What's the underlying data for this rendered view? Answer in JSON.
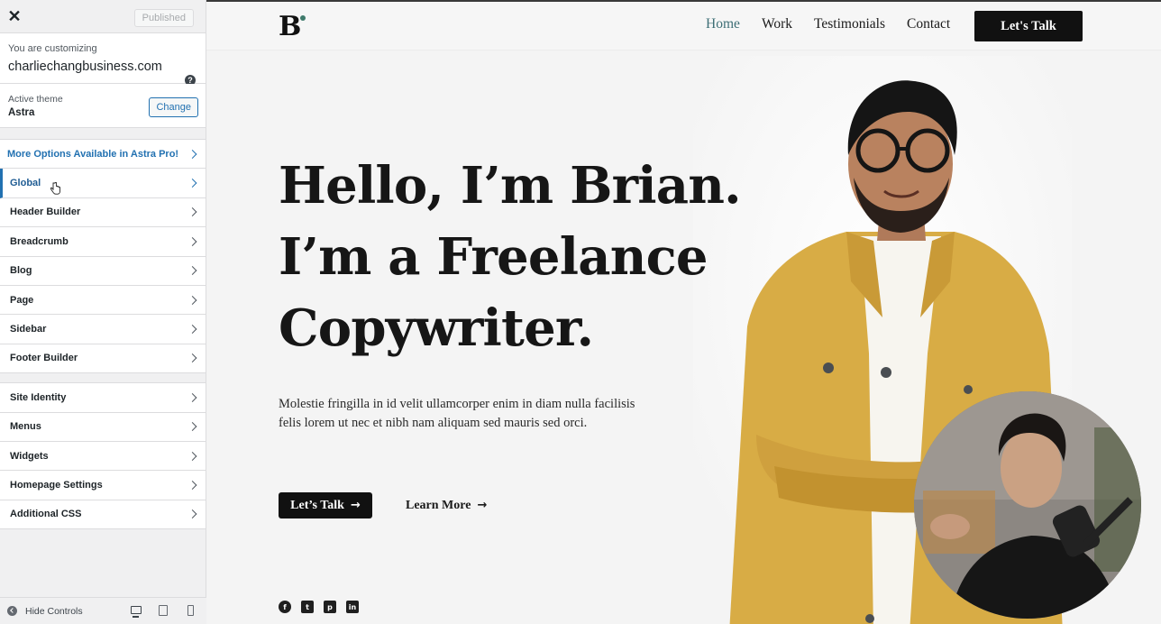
{
  "customizer": {
    "close_icon": "close-icon",
    "published_label": "Published",
    "customizing_label": "You are customizing",
    "site_name": "charliechangbusiness.com",
    "help_icon": "help-icon",
    "active_theme_label": "Active theme",
    "theme_name": "Astra",
    "change_label": "Change",
    "pro_label": "More Options Available in Astra Pro!",
    "panels": [
      {
        "label": "Global"
      },
      {
        "label": "Header Builder"
      },
      {
        "label": "Breadcrumb"
      },
      {
        "label": "Blog"
      },
      {
        "label": "Page"
      },
      {
        "label": "Sidebar"
      },
      {
        "label": "Footer Builder"
      }
    ],
    "panels2": [
      {
        "label": "Site Identity"
      },
      {
        "label": "Menus"
      },
      {
        "label": "Widgets"
      },
      {
        "label": "Homepage Settings"
      },
      {
        "label": "Additional CSS"
      }
    ],
    "hide_controls_label": "Hide Controls"
  },
  "site": {
    "logo": "B",
    "nav": {
      "home": "Home",
      "work": "Work",
      "testimonials": "Testimonials",
      "contact": "Contact"
    },
    "header_cta": "Let's Talk",
    "hero": {
      "line1": "Hello, I’m Brian.",
      "line2": "I’m a Freelance",
      "line3": "Copywriter.",
      "text": "Molestie fringilla in id velit ullamcorper enim in diam nulla facilisis felis lorem ut nec et nibh nam aliquam sed mauris sed orci.",
      "btn_talk": "Let’s Talk",
      "btn_learn": "Learn More"
    },
    "social_icons": [
      "facebook-icon",
      "twitter-icon",
      "pinterest-icon",
      "linkedin-icon"
    ],
    "colors": {
      "accent": "#2271b1",
      "nav_active": "#3d6e75",
      "jacket": "#d8ac45"
    }
  }
}
